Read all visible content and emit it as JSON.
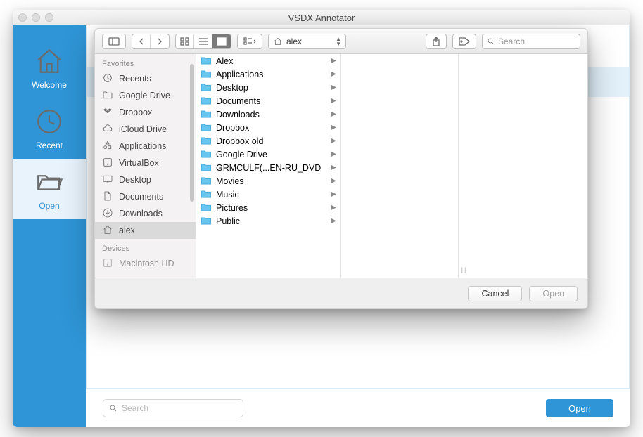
{
  "app": {
    "title": "VSDX Annotator"
  },
  "nav": {
    "items": [
      {
        "id": "welcome",
        "label": "Welcome"
      },
      {
        "id": "recent",
        "label": "Recent"
      },
      {
        "id": "open",
        "label": "Open"
      }
    ],
    "active": "open"
  },
  "main_search_placeholder": "Search",
  "main_open_label": "Open",
  "dialog": {
    "path_label": "alex",
    "search_placeholder": "Search",
    "sidebar": {
      "favorites_header": "Favorites",
      "devices_header": "Devices",
      "favorites": [
        {
          "label": "Recents",
          "icon": "clock"
        },
        {
          "label": "Google Drive",
          "icon": "folder-plain"
        },
        {
          "label": "Dropbox",
          "icon": "dropbox"
        },
        {
          "label": "iCloud Drive",
          "icon": "cloud"
        },
        {
          "label": "Applications",
          "icon": "apps"
        },
        {
          "label": "VirtualBox",
          "icon": "disk"
        },
        {
          "label": "Desktop",
          "icon": "desktop"
        },
        {
          "label": "Documents",
          "icon": "doc"
        },
        {
          "label": "Downloads",
          "icon": "download"
        },
        {
          "label": "alex",
          "icon": "home",
          "selected": true
        }
      ],
      "devices": [
        {
          "label": "Macintosh HD",
          "icon": "disk"
        }
      ]
    },
    "column": [
      {
        "label": "Alex"
      },
      {
        "label": "Applications"
      },
      {
        "label": "Desktop"
      },
      {
        "label": "Documents"
      },
      {
        "label": "Downloads"
      },
      {
        "label": "Dropbox"
      },
      {
        "label": "Dropbox old"
      },
      {
        "label": "Google Drive"
      },
      {
        "label": "GRMCULF(...EN-RU_DVD"
      },
      {
        "label": "Movies"
      },
      {
        "label": "Music"
      },
      {
        "label": "Pictures"
      },
      {
        "label": "Public"
      }
    ],
    "buttons": {
      "cancel": "Cancel",
      "open": "Open"
    }
  }
}
